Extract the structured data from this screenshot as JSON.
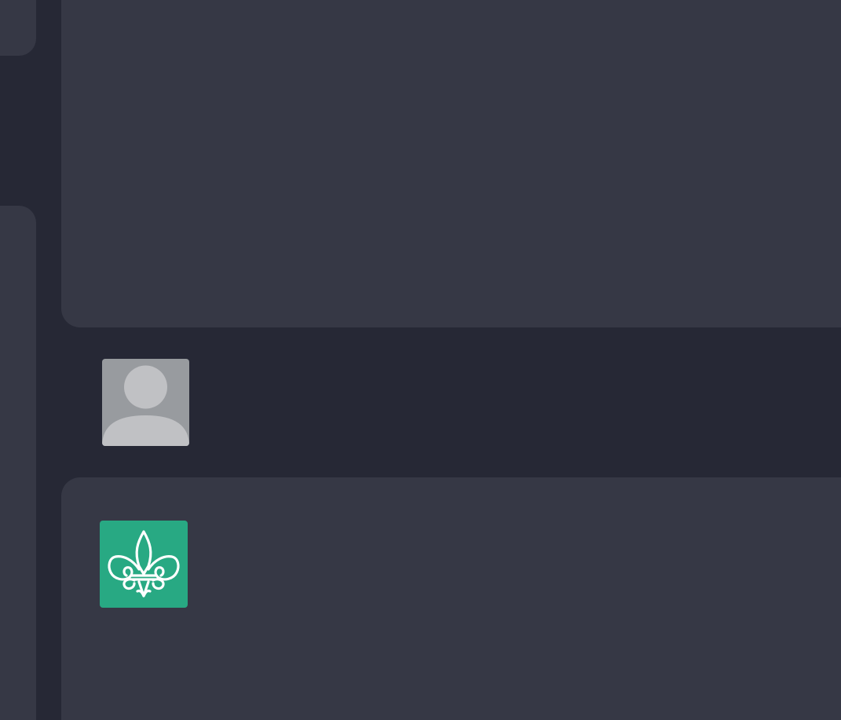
{
  "colors": {
    "background": "#262835",
    "panel": "#363845",
    "default_avatar_bg": "#989b9f",
    "default_avatar_fg": "#c0c1c4",
    "brand_avatar_bg": "#28a983",
    "brand_avatar_fg": "#ffffff"
  },
  "avatars": {
    "user": {
      "icon": "default-user-silhouette-icon"
    },
    "brand": {
      "icon": "fleur-de-lis-icon"
    }
  }
}
